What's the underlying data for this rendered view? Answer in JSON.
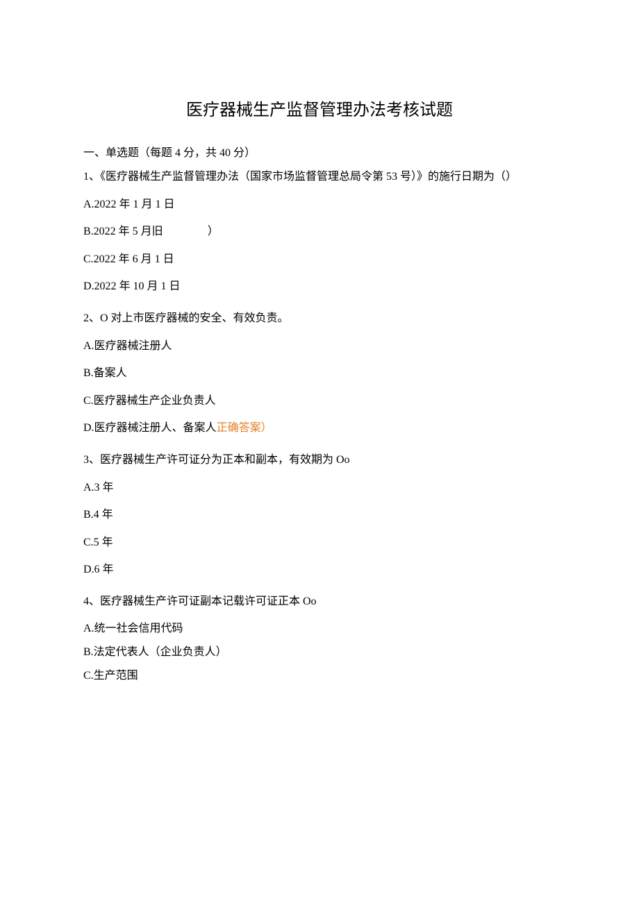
{
  "title": "医疗器械生产监督管理办法考核试题",
  "section1": {
    "header": "一、单选题（每题 4 分，共 40 分）",
    "q1": {
      "text": "1、《医疗器械生产监督管理办法（国家市场监督管理总局令第 53 号）》的施行日期为（）",
      "a": "A.2022 年 1 月 1 日",
      "b_prefix": "B.2022 年 5 月旧",
      "b_suffix": "）",
      "c": "C.2022 年 6 月 1 日",
      "d": "D.2022 年 10 月 1 日"
    },
    "q2": {
      "text": "2、O 对上市医疗器械的安全、有效负责。",
      "a": "A.医疗器械注册人",
      "b": "B.备案人",
      "c": "C.医疗器械生产企业负责人",
      "d_prefix": "D.医疗器械注册人、备案人",
      "d_correct": "正确答案）"
    },
    "q3": {
      "text": "3、医疗器械生产许可证分为正本和副本，有效期为 Oo",
      "a": "A.3 年",
      "b": "B.4 年",
      "c": "C.5 年",
      "d": "D.6 年"
    },
    "q4": {
      "text": "4、医疗器械生产许可证副本记载许可证正本 Oo",
      "a": "A.统一社会信用代码",
      "b": "B.法定代表人（企业负责人）",
      "c": "C.生产范围"
    }
  }
}
